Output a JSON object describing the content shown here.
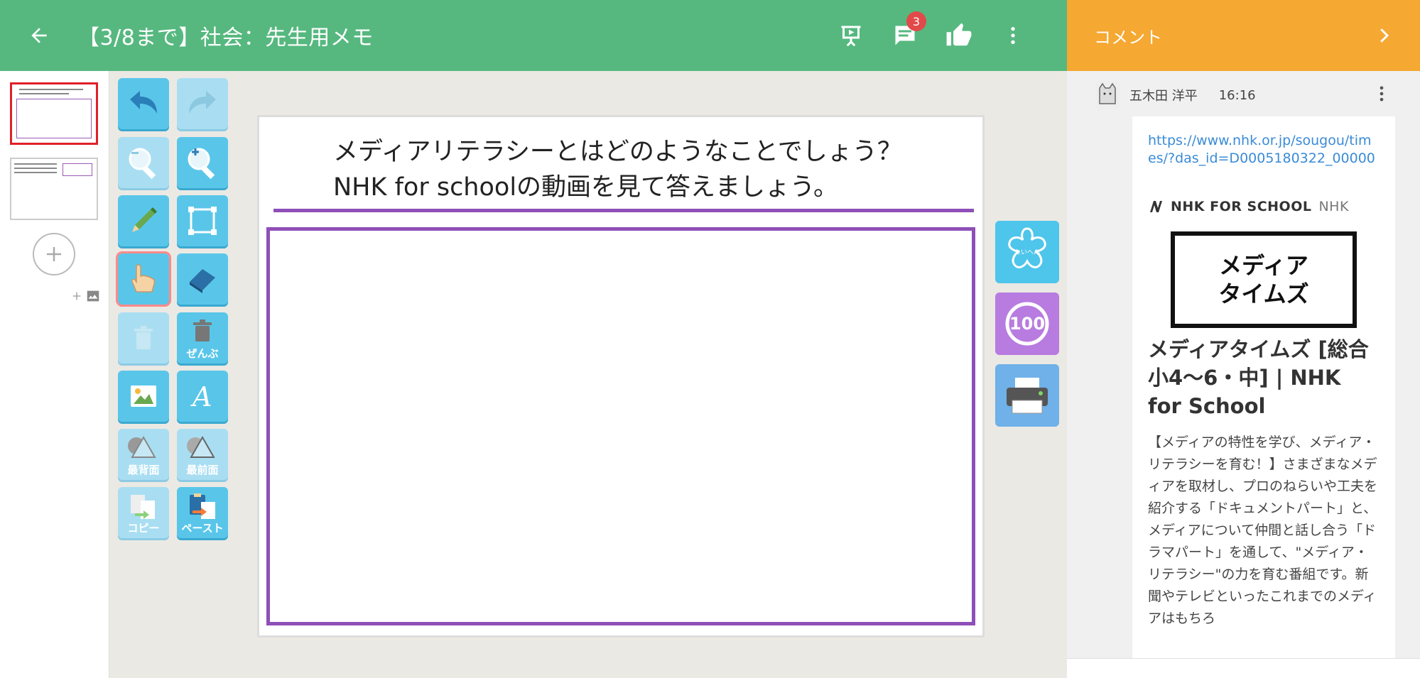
{
  "header": {
    "title": "【3/8まで】社会：先生用メモ",
    "comment_badge": "3",
    "color": "#56b87f"
  },
  "comments": {
    "header_label": "コメント",
    "header_color": "#f5a832",
    "items": [
      {
        "user": "五木田 洋平",
        "time": "16:16",
        "link": "https://www.nhk.or.jp/sougou/times/?das_id=D0005180322_00000",
        "site_name": "NHK FOR SCHOOL",
        "site_owner": "NHK",
        "logo_line1": "メディア",
        "logo_line2": "タイムズ",
        "title": "メディアタイムズ [総合 小4〜6・中] | NHK for School",
        "description": "【メディアの特性を学び、メディア・リテラシーを育む！】さまざまなメディアを取材し、プロのねらいや工夫を紹介する「ドキュメントパート」と、メディアについて仲間と話し合う「ドラマパート」を通して、\"メディア・リテラシー\"の力を育む番組です。新聞やテレビといったこれまでのメディアはもちろ"
      }
    ]
  },
  "toolbar": {
    "delete_all_label": "ぜんぶ",
    "send_back_label": "最背面",
    "bring_front_label": "最前面",
    "copy_label": "コピー",
    "paste_label": "ペースト",
    "tool_color": "#59c6e9"
  },
  "canvas": {
    "question_line1": "メディアリテラシーとはどのようなことでしょう？",
    "question_line2": "NHK for schoolの動画を見て答えましょう。",
    "frame_color": "#8e4fb8"
  },
  "stamps": {
    "score_label": "100"
  }
}
